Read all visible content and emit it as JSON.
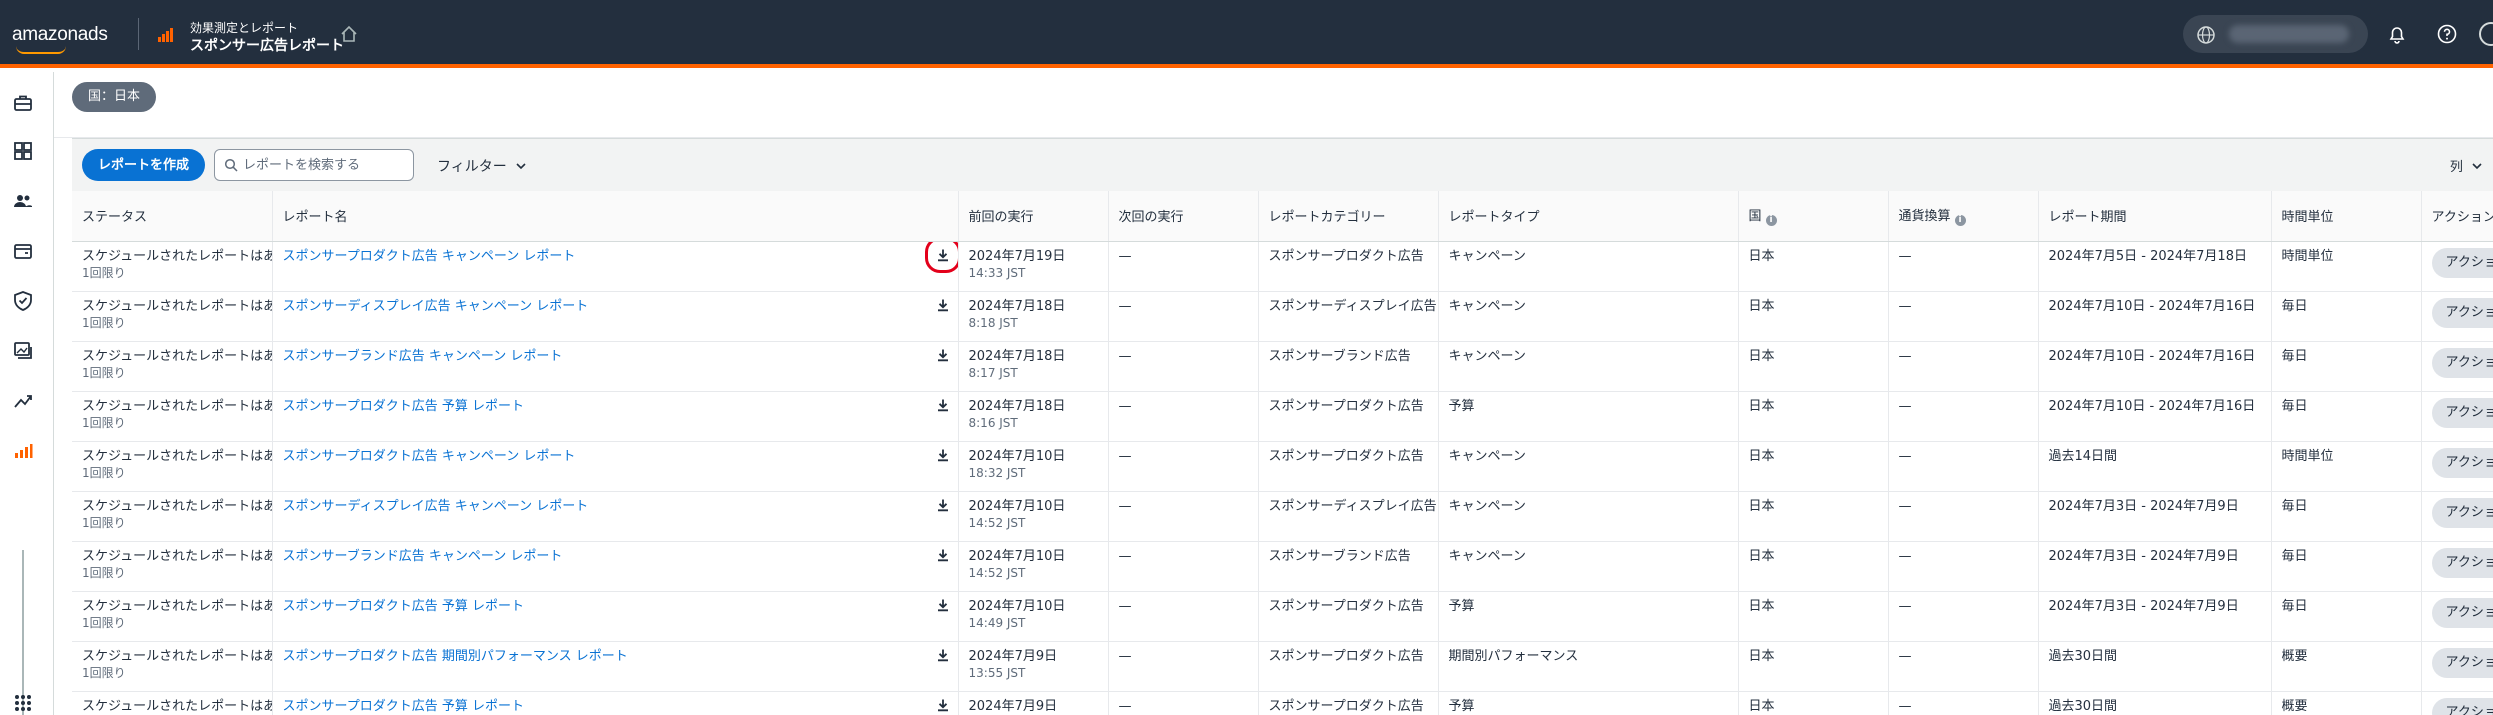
{
  "topbar": {
    "logo_text": "amazonads",
    "breadcrumb_sub": "効果測定とレポート",
    "breadcrumb_title": "スポンサー広告レポート"
  },
  "filter_chip": "国：日本",
  "toolbar": {
    "create_label": "レポートを作成",
    "search_placeholder": "レポートを検索する",
    "filter_label": "フィルター",
    "columns_label": "列"
  },
  "table": {
    "headers": [
      "ステータス",
      "レポート名",
      "前回の実行",
      "次回の実行",
      "レポートカテゴリー",
      "レポートタイプ",
      "国",
      "通貨換算",
      "レポート期間",
      "時間単位",
      "アクション"
    ],
    "rows": [
      {
        "status": "スケジュールされたレポートはありません",
        "status_sub": "1回限り",
        "name": "スポンサープロダクト広告 キャンペーン レポート",
        "last_run_date": "2024年7月19日",
        "last_run_time": "14:33 JST",
        "next_run": "—",
        "category": "スポンサープロダクト広告",
        "type": "キャンペーン",
        "country": "日本",
        "currency": "—",
        "period": "2024年7月5日 - 2024年7月18日",
        "unit": "時間単位",
        "action": "アクション"
      },
      {
        "status": "スケジュールされたレポートはありません",
        "status_sub": "1回限り",
        "name": "スポンサーディスプレイ広告 キャンペーン レポート",
        "last_run_date": "2024年7月18日",
        "last_run_time": "8:18 JST",
        "next_run": "—",
        "category": "スポンサーディスプレイ広告",
        "type": "キャンペーン",
        "country": "日本",
        "currency": "—",
        "period": "2024年7月10日 - 2024年7月16日",
        "unit": "毎日",
        "action": "アクション"
      },
      {
        "status": "スケジュールされたレポートはありません",
        "status_sub": "1回限り",
        "name": "スポンサーブランド広告 キャンペーン レポート",
        "last_run_date": "2024年7月18日",
        "last_run_time": "8:17 JST",
        "next_run": "—",
        "category": "スポンサーブランド広告",
        "type": "キャンペーン",
        "country": "日本",
        "currency": "—",
        "period": "2024年7月10日 - 2024年7月16日",
        "unit": "毎日",
        "action": "アクション"
      },
      {
        "status": "スケジュールされたレポートはありません",
        "status_sub": "1回限り",
        "name": "スポンサープロダクト広告 予算 レポート",
        "last_run_date": "2024年7月18日",
        "last_run_time": "8:16 JST",
        "next_run": "—",
        "category": "スポンサープロダクト広告",
        "type": "予算",
        "country": "日本",
        "currency": "—",
        "period": "2024年7月10日 - 2024年7月16日",
        "unit": "毎日",
        "action": "アクション"
      },
      {
        "status": "スケジュールされたレポートはありません",
        "status_sub": "1回限り",
        "name": "スポンサープロダクト広告 キャンペーン レポート",
        "last_run_date": "2024年7月10日",
        "last_run_time": "18:32 JST",
        "next_run": "—",
        "category": "スポンサープロダクト広告",
        "type": "キャンペーン",
        "country": "日本",
        "currency": "—",
        "period": "過去14日間",
        "unit": "時間単位",
        "action": "アクション"
      },
      {
        "status": "スケジュールされたレポートはありません",
        "status_sub": "1回限り",
        "name": "スポンサーディスプレイ広告 キャンペーン レポート",
        "last_run_date": "2024年7月10日",
        "last_run_time": "14:52 JST",
        "next_run": "—",
        "category": "スポンサーディスプレイ広告",
        "type": "キャンペーン",
        "country": "日本",
        "currency": "—",
        "period": "2024年7月3日 - 2024年7月9日",
        "unit": "毎日",
        "action": "アクション"
      },
      {
        "status": "スケジュールされたレポートはありません",
        "status_sub": "1回限り",
        "name": "スポンサーブランド広告 キャンペーン レポート",
        "last_run_date": "2024年7月10日",
        "last_run_time": "14:52 JST",
        "next_run": "—",
        "category": "スポンサーブランド広告",
        "type": "キャンペーン",
        "country": "日本",
        "currency": "—",
        "period": "2024年7月3日 - 2024年7月9日",
        "unit": "毎日",
        "action": "アクション"
      },
      {
        "status": "スケジュールされたレポートはありません",
        "status_sub": "1回限り",
        "name": "スポンサープロダクト広告 予算 レポート",
        "last_run_date": "2024年7月10日",
        "last_run_time": "14:49 JST",
        "next_run": "—",
        "category": "スポンサープロダクト広告",
        "type": "予算",
        "country": "日本",
        "currency": "—",
        "period": "2024年7月3日 - 2024年7月9日",
        "unit": "毎日",
        "action": "アクション"
      },
      {
        "status": "スケジュールされたレポートはありません",
        "status_sub": "1回限り",
        "name": "スポンサープロダクト広告 期間別パフォーマンス レポート",
        "last_run_date": "2024年7月9日",
        "last_run_time": "13:55 JST",
        "next_run": "—",
        "category": "スポンサープロダクト広告",
        "type": "期間別パフォーマンス",
        "country": "日本",
        "currency": "—",
        "period": "過去30日間",
        "unit": "概要",
        "action": "アクション"
      },
      {
        "status": "スケジュールされたレポートはありません",
        "status_sub": "1回限り",
        "name": "スポンサープロダクト広告 予算 レポート",
        "last_run_date": "2024年7月9日",
        "last_run_time": "",
        "next_run": "—",
        "category": "スポンサープロダクト広告",
        "type": "予算",
        "country": "日本",
        "currency": "—",
        "period": "過去30日間",
        "unit": "概要",
        "action": "アクション"
      }
    ]
  },
  "colors": {
    "topbar_bg": "#232f3e",
    "accent_orange": "#ff6200",
    "primary_blue": "#0972d3",
    "highlight_red": "#e3001b"
  },
  "icons": [
    "bars-chart-icon",
    "home-icon",
    "globe-icon",
    "bell-icon",
    "help-icon",
    "briefcase-icon",
    "dashboard-icon",
    "audience-icon",
    "wallet-icon",
    "shield-icon",
    "media-icon",
    "trend-icon",
    "reports-icon",
    "apps-grid-icon",
    "search-icon",
    "chevron-down-icon",
    "download-icon",
    "info-icon"
  ]
}
